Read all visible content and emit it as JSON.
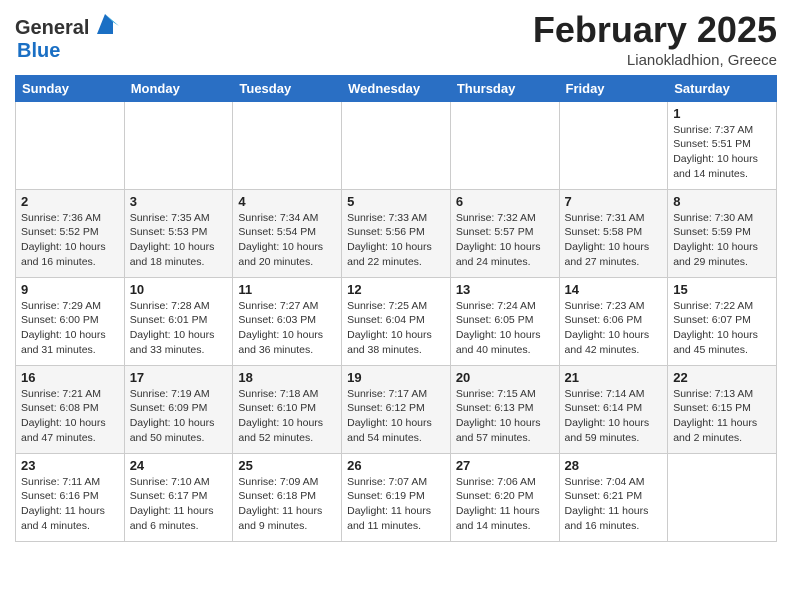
{
  "header": {
    "logo_general": "General",
    "logo_blue": "Blue",
    "title": "February 2025",
    "subtitle": "Lianokladhion, Greece"
  },
  "weekdays": [
    "Sunday",
    "Monday",
    "Tuesday",
    "Wednesday",
    "Thursday",
    "Friday",
    "Saturday"
  ],
  "weeks": [
    [
      {
        "day": "",
        "info": ""
      },
      {
        "day": "",
        "info": ""
      },
      {
        "day": "",
        "info": ""
      },
      {
        "day": "",
        "info": ""
      },
      {
        "day": "",
        "info": ""
      },
      {
        "day": "",
        "info": ""
      },
      {
        "day": "1",
        "info": "Sunrise: 7:37 AM\nSunset: 5:51 PM\nDaylight: 10 hours and 14 minutes."
      }
    ],
    [
      {
        "day": "2",
        "info": "Sunrise: 7:36 AM\nSunset: 5:52 PM\nDaylight: 10 hours and 16 minutes."
      },
      {
        "day": "3",
        "info": "Sunrise: 7:35 AM\nSunset: 5:53 PM\nDaylight: 10 hours and 18 minutes."
      },
      {
        "day": "4",
        "info": "Sunrise: 7:34 AM\nSunset: 5:54 PM\nDaylight: 10 hours and 20 minutes."
      },
      {
        "day": "5",
        "info": "Sunrise: 7:33 AM\nSunset: 5:56 PM\nDaylight: 10 hours and 22 minutes."
      },
      {
        "day": "6",
        "info": "Sunrise: 7:32 AM\nSunset: 5:57 PM\nDaylight: 10 hours and 24 minutes."
      },
      {
        "day": "7",
        "info": "Sunrise: 7:31 AM\nSunset: 5:58 PM\nDaylight: 10 hours and 27 minutes."
      },
      {
        "day": "8",
        "info": "Sunrise: 7:30 AM\nSunset: 5:59 PM\nDaylight: 10 hours and 29 minutes."
      }
    ],
    [
      {
        "day": "9",
        "info": "Sunrise: 7:29 AM\nSunset: 6:00 PM\nDaylight: 10 hours and 31 minutes."
      },
      {
        "day": "10",
        "info": "Sunrise: 7:28 AM\nSunset: 6:01 PM\nDaylight: 10 hours and 33 minutes."
      },
      {
        "day": "11",
        "info": "Sunrise: 7:27 AM\nSunset: 6:03 PM\nDaylight: 10 hours and 36 minutes."
      },
      {
        "day": "12",
        "info": "Sunrise: 7:25 AM\nSunset: 6:04 PM\nDaylight: 10 hours and 38 minutes."
      },
      {
        "day": "13",
        "info": "Sunrise: 7:24 AM\nSunset: 6:05 PM\nDaylight: 10 hours and 40 minutes."
      },
      {
        "day": "14",
        "info": "Sunrise: 7:23 AM\nSunset: 6:06 PM\nDaylight: 10 hours and 42 minutes."
      },
      {
        "day": "15",
        "info": "Sunrise: 7:22 AM\nSunset: 6:07 PM\nDaylight: 10 hours and 45 minutes."
      }
    ],
    [
      {
        "day": "16",
        "info": "Sunrise: 7:21 AM\nSunset: 6:08 PM\nDaylight: 10 hours and 47 minutes."
      },
      {
        "day": "17",
        "info": "Sunrise: 7:19 AM\nSunset: 6:09 PM\nDaylight: 10 hours and 50 minutes."
      },
      {
        "day": "18",
        "info": "Sunrise: 7:18 AM\nSunset: 6:10 PM\nDaylight: 10 hours and 52 minutes."
      },
      {
        "day": "19",
        "info": "Sunrise: 7:17 AM\nSunset: 6:12 PM\nDaylight: 10 hours and 54 minutes."
      },
      {
        "day": "20",
        "info": "Sunrise: 7:15 AM\nSunset: 6:13 PM\nDaylight: 10 hours and 57 minutes."
      },
      {
        "day": "21",
        "info": "Sunrise: 7:14 AM\nSunset: 6:14 PM\nDaylight: 10 hours and 59 minutes."
      },
      {
        "day": "22",
        "info": "Sunrise: 7:13 AM\nSunset: 6:15 PM\nDaylight: 11 hours and 2 minutes."
      }
    ],
    [
      {
        "day": "23",
        "info": "Sunrise: 7:11 AM\nSunset: 6:16 PM\nDaylight: 11 hours and 4 minutes."
      },
      {
        "day": "24",
        "info": "Sunrise: 7:10 AM\nSunset: 6:17 PM\nDaylight: 11 hours and 6 minutes."
      },
      {
        "day": "25",
        "info": "Sunrise: 7:09 AM\nSunset: 6:18 PM\nDaylight: 11 hours and 9 minutes."
      },
      {
        "day": "26",
        "info": "Sunrise: 7:07 AM\nSunset: 6:19 PM\nDaylight: 11 hours and 11 minutes."
      },
      {
        "day": "27",
        "info": "Sunrise: 7:06 AM\nSunset: 6:20 PM\nDaylight: 11 hours and 14 minutes."
      },
      {
        "day": "28",
        "info": "Sunrise: 7:04 AM\nSunset: 6:21 PM\nDaylight: 11 hours and 16 minutes."
      },
      {
        "day": "",
        "info": ""
      }
    ]
  ]
}
